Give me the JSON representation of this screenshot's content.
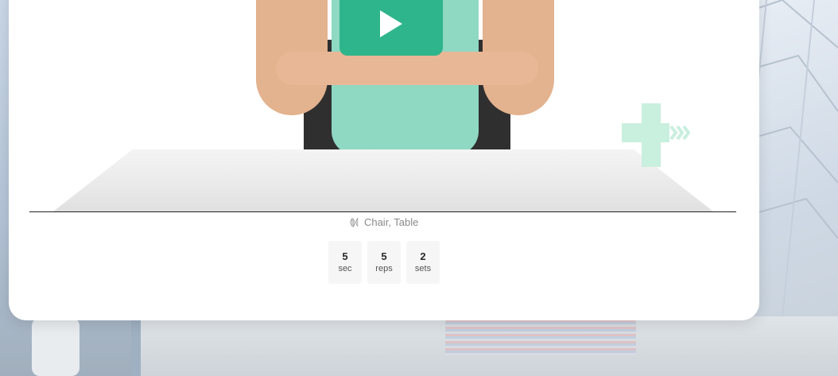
{
  "exercise": {
    "equipment_icon": "dumbbell-icon",
    "equipment_icon_glyph": "⟬⟭⟬",
    "equipment_label": "Chair, Table",
    "stats": [
      {
        "value": "5",
        "unit": "sec"
      },
      {
        "value": "5",
        "unit": "reps"
      },
      {
        "value": "2",
        "unit": "sets"
      }
    ]
  },
  "video": {
    "play_icon": "play-icon"
  },
  "colors": {
    "accent": "#2fb58b",
    "logo": "#c9efde"
  }
}
